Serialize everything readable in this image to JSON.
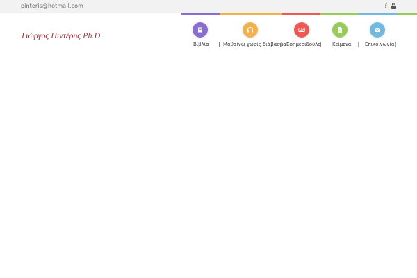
{
  "topbar": {
    "email": "pinteris@hotmail.com",
    "social": [
      {
        "icon": "facebook-icon",
        "glyph": "f"
      },
      {
        "icon": "youtube-icon"
      }
    ]
  },
  "logo": {
    "text": "Γιώργος Πιντέρης Ph.D."
  },
  "nav": {
    "items": [
      {
        "label": "Βιβλία",
        "icon": "book-icon",
        "color": "#8b6fcf"
      },
      {
        "label": "Μαθαίνω χωρίς διάβασμα",
        "icon": "headphones-icon",
        "color": "#f2b14f"
      },
      {
        "label": "Εφημεριδούλα",
        "icon": "keyboard-icon",
        "color": "#ec5a55"
      },
      {
        "label": "Κείμενα",
        "icon": "document-icon",
        "color": "#98cb5b"
      },
      {
        "label": "Επικοινωνία",
        "icon": "envelope-icon",
        "color": "#72b9e0"
      }
    ],
    "separator_colors": [
      "#8b6fcf",
      "#f2b14f",
      "#ec5a55",
      "#98cb5b",
      "#72b9e0"
    ]
  },
  "colorbar": [
    "#8b6fcf",
    "#f2b14f",
    "#ec5a55",
    "#98cb5b",
    "#72b9e0",
    "#98cb5b"
  ]
}
